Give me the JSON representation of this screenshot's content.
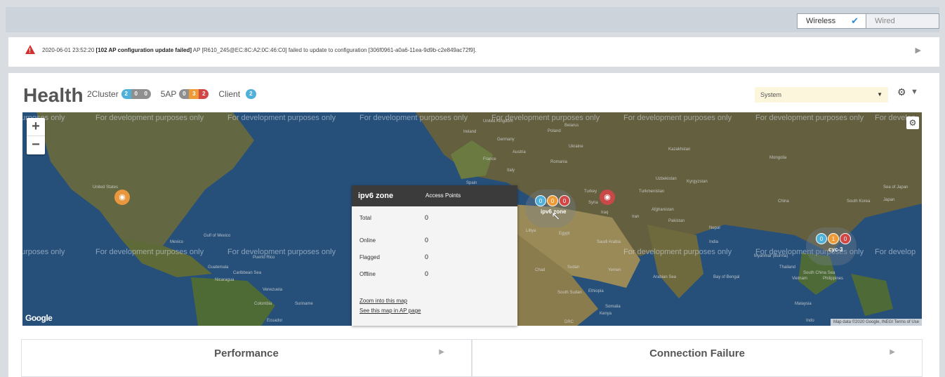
{
  "topbar": {
    "wireless_label": "Wireless",
    "wired_label": "Wired",
    "check_glyph": "✔"
  },
  "alert": {
    "icon": "warning-icon",
    "timestamp": "2020-06-01 23:52:20",
    "event": "[102 AP configuration update failed]",
    "message": "AP [R610_245@EC:8C:A2:0C:46:C0] failed to update to configuration [306f0961-a0a6-11ea-9d9b-c2e849ac72f9].",
    "expand_glyph": "▶"
  },
  "health": {
    "title": "Health",
    "cluster_label": "2Cluster",
    "cluster_counts": [
      "2",
      "0",
      "0"
    ],
    "ap_label": "5AP",
    "ap_counts": [
      "0",
      "3",
      "2"
    ],
    "client_label": "Client",
    "client_count": "2",
    "system_select": "System",
    "caret_glyph": "▼",
    "gear_glyph": "⚙",
    "filter_glyph": "▼"
  },
  "map": {
    "dev_text": "For development purposes only",
    "dev_text_left_edge": "urposes only",
    "dev_text_left_edge_top": "urposes only",
    "dev_text_right_edge": "For develop",
    "zoom_in": "+",
    "zoom_out": "−",
    "gear_glyph": "⚙",
    "countries": {
      "united_states": "United States",
      "mexico": "Mexico",
      "ireland": "Ireland",
      "united_kingdom": "United Kingdom",
      "poland": "Poland",
      "belarus": "Belarus",
      "germany": "Germany",
      "ukraine": "Ukraine",
      "france": "France",
      "romania": "Romania",
      "austria": "Austria",
      "italy": "Italy",
      "spain": "Spain",
      "kazakhstan": "Kazakhstan",
      "mongolia": "Mongolia",
      "uzbekistan": "Uzbekistan",
      "kyrgyzstan": "Kyrgyzstan",
      "turkey": "Turkey",
      "turkmenistan": "Turkmenistan",
      "china": "China",
      "south_korea": "South Korea",
      "japan": "Japan",
      "syria": "Syria",
      "iraq": "Iraq",
      "iran": "Iran",
      "afghanistan": "Afghanistan",
      "pakistan": "Pakistan",
      "libya": "Libya",
      "egypt": "Egypt",
      "saudi_arabia": "Saudi Arabia",
      "india": "India",
      "nepal": "Nepal",
      "thailand": "Thailand",
      "vietnam": "Vietnam",
      "philippines": "Philippines",
      "chad": "Chad",
      "sudan": "Sudan",
      "yemen": "Yemen",
      "south_sudan": "South Sudan",
      "ethiopia": "Ethiopia",
      "somalia": "Somalia",
      "kenya": "Kenya",
      "drc": "DRC",
      "malaysia": "Malaysia",
      "venezuela": "Venezuela",
      "colombia": "Colombia",
      "guatemala": "Guatemala",
      "nicaragua": "Nicaragua",
      "caribbean_sea": "Caribbean Sea",
      "gulf_of_mexico": "Gulf of Mexico",
      "puerto_rico": "Puerto Rico",
      "arabian_sea": "Arabian Sea",
      "bay_of_bengal": "Bay of Bengal",
      "south_china_sea": "South China Sea",
      "sea_of_japan": "Sea of Japan",
      "myanmar": "Myanmar (Burma)",
      "suriname": "Suriname",
      "ecuador": "Ecuador",
      "indo": "Indo"
    },
    "zone_cluster": {
      "counts": [
        "0",
        "0",
        "0"
      ],
      "name": "ipv6 zone",
      "colors": [
        "#4fb0da",
        "#ee9a36",
        "#d24646"
      ]
    },
    "cyc_cluster": {
      "counts": [
        "0",
        "1",
        "0"
      ],
      "name": "cyc-3",
      "colors": [
        "#4fb0da",
        "#ee9a36",
        "#d24646"
      ]
    },
    "wifi_glyph": "◉",
    "cursor_glyph": "↖",
    "google": "Google",
    "attribution": "Map data ©2020 Google, INEGI   Terms of Use"
  },
  "popup": {
    "zone": "ipv6 zone",
    "header_right": "Access Points",
    "rows": [
      {
        "label": "Total",
        "value": "0"
      },
      {
        "label": "Online",
        "value": "0"
      },
      {
        "label": "Flagged",
        "value": "0"
      },
      {
        "label": "Offline",
        "value": "0"
      }
    ],
    "zoom_link": "Zoom into this map",
    "ap_page_link": "See this map in AP page"
  },
  "cards": {
    "performance": "Performance",
    "connection_failure": "Connection Failure",
    "arrow_glyph": "▶"
  }
}
